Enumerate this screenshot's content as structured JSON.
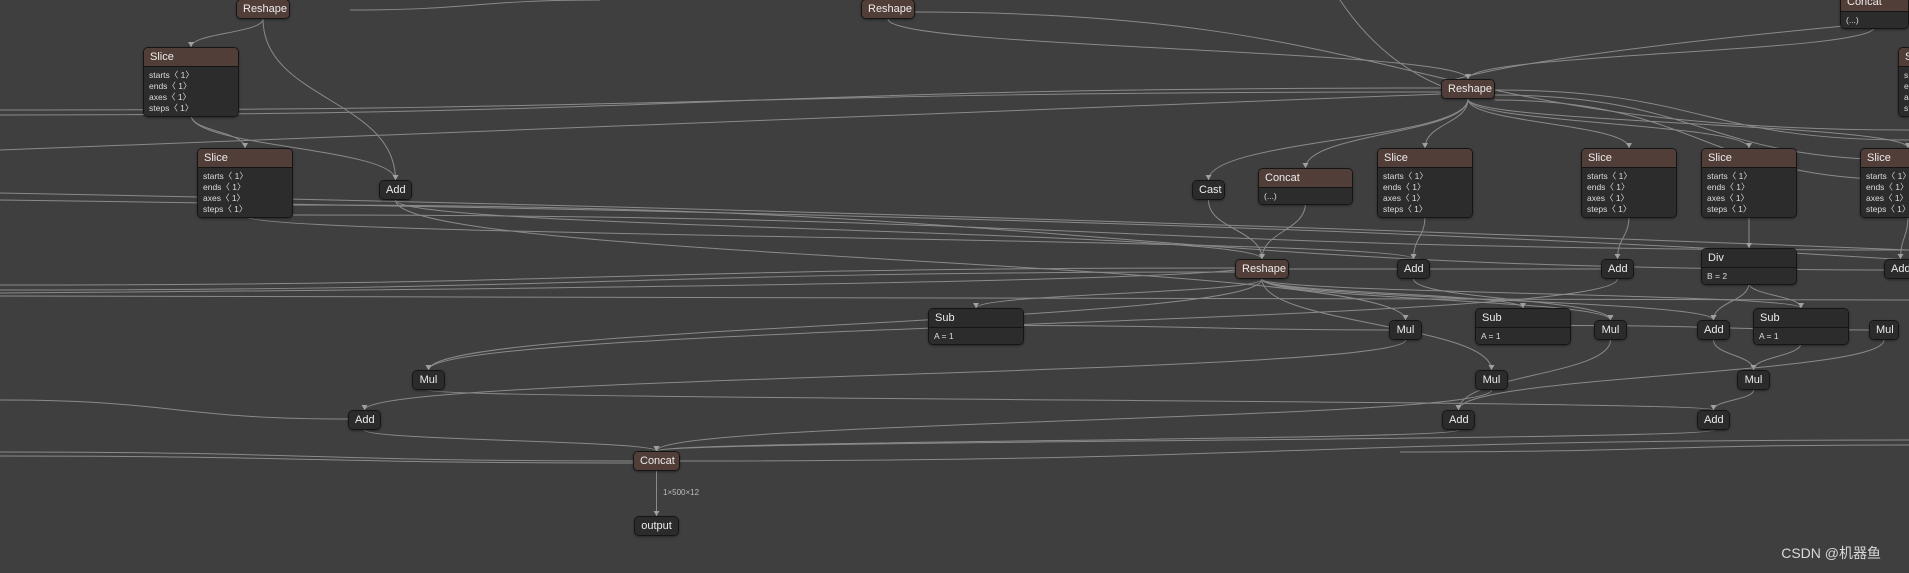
{
  "graph": {
    "nodes": [
      {
        "id": "reshape_top1",
        "op": "Reshape",
        "style": "layer"
      },
      {
        "id": "reshape_top2",
        "op": "Reshape",
        "style": "layer"
      },
      {
        "id": "concat_topright",
        "op": "Concat",
        "style": "layer",
        "attrs": [
          "(...)"
        ]
      },
      {
        "id": "slice1",
        "op": "Slice",
        "style": "layer",
        "attrs": [
          "starts〈 1〉",
          "ends〈 1〉",
          "axes〈 1〉",
          "steps〈 1〉"
        ]
      },
      {
        "id": "slice_right_edge",
        "op": "S",
        "style": "layer",
        "attrs": [
          "s",
          "e",
          "a",
          "s"
        ]
      },
      {
        "id": "reshape_mid",
        "op": "Reshape",
        "style": "layer"
      },
      {
        "id": "slice2",
        "op": "Slice",
        "style": "layer",
        "attrs": [
          "starts〈 1〉",
          "ends〈 1〉",
          "axes〈 1〉",
          "steps〈 1〉"
        ]
      },
      {
        "id": "add1",
        "op": "Add",
        "style": "op"
      },
      {
        "id": "cast",
        "op": "Cast",
        "style": "op"
      },
      {
        "id": "concat_mid",
        "op": "Concat",
        "style": "layer",
        "attrs": [
          "(...)"
        ]
      },
      {
        "id": "slice3",
        "op": "Slice",
        "style": "layer",
        "attrs": [
          "starts〈 1〉",
          "ends〈 1〉",
          "axes〈 1〉",
          "steps〈 1〉"
        ]
      },
      {
        "id": "slice4",
        "op": "Slice",
        "style": "layer",
        "attrs": [
          "starts〈 1〉",
          "ends〈 1〉",
          "axes〈 1〉",
          "steps〈 1〉"
        ]
      },
      {
        "id": "slice5",
        "op": "Slice",
        "style": "layer",
        "attrs": [
          "starts〈 1〉",
          "ends〈 1〉",
          "axes〈 1〉",
          "steps〈 1〉"
        ]
      },
      {
        "id": "slice6",
        "op": "Slice",
        "style": "layer",
        "attrs": [
          "starts〈 1〉",
          "ends〈 1〉",
          "axes〈 1〉",
          "steps〈 1〉"
        ]
      },
      {
        "id": "reshape_main",
        "op": "Reshape",
        "style": "layer"
      },
      {
        "id": "add2",
        "op": "Add",
        "style": "op"
      },
      {
        "id": "add3",
        "op": "Add",
        "style": "op"
      },
      {
        "id": "div",
        "op": "Div",
        "style": "op",
        "attrs": [
          "B = 2"
        ]
      },
      {
        "id": "add4",
        "op": "Add",
        "style": "op"
      },
      {
        "id": "sub1",
        "op": "Sub",
        "style": "op",
        "attrs": [
          "A = 1"
        ]
      },
      {
        "id": "mul1",
        "op": "Mul",
        "style": "op"
      },
      {
        "id": "sub2",
        "op": "Sub",
        "style": "op",
        "attrs": [
          "A = 1"
        ]
      },
      {
        "id": "mul2",
        "op": "Mul",
        "style": "op"
      },
      {
        "id": "add5",
        "op": "Add",
        "style": "op"
      },
      {
        "id": "sub3",
        "op": "Sub",
        "style": "op",
        "attrs": [
          "A = 1"
        ]
      },
      {
        "id": "mul3",
        "op": "Mul",
        "style": "op"
      },
      {
        "id": "mul4",
        "op": "Mul",
        "style": "op"
      },
      {
        "id": "mul5",
        "op": "Mul",
        "style": "op"
      },
      {
        "id": "mul6",
        "op": "Mul",
        "style": "op"
      },
      {
        "id": "add6",
        "op": "Add",
        "style": "op"
      },
      {
        "id": "add7",
        "op": "Add",
        "style": "op"
      },
      {
        "id": "add8",
        "op": "Add",
        "style": "op"
      },
      {
        "id": "concat_final",
        "op": "Concat",
        "style": "layer"
      },
      {
        "id": "output",
        "op": "output",
        "style": "io"
      }
    ],
    "edges": [
      [
        "reshape_top1",
        "add1"
      ],
      [
        "reshape_top1",
        "slice1"
      ],
      [
        "reshape_top2",
        "reshape_mid"
      ],
      [
        "concat_topright",
        "reshape_mid"
      ],
      [
        "slice1",
        "slice2"
      ],
      [
        "slice1",
        "add1"
      ],
      [
        "reshape_mid",
        "cast"
      ],
      [
        "reshape_mid",
        "concat_mid"
      ],
      [
        "reshape_mid",
        "slice3"
      ],
      [
        "reshape_mid",
        "slice4"
      ],
      [
        "reshape_mid",
        "slice5"
      ],
      [
        "reshape_mid",
        "slice6"
      ],
      [
        "slice2",
        "add2"
      ],
      [
        "add1",
        "reshape_main"
      ],
      [
        "add1",
        "mul1"
      ],
      [
        "cast",
        "reshape_main"
      ],
      [
        "concat_mid",
        "reshape_main"
      ],
      [
        "slice3",
        "add2"
      ],
      [
        "slice4",
        "add3"
      ],
      [
        "slice5",
        "div"
      ],
      [
        "slice6",
        "add4"
      ],
      [
        "reshape_main",
        "sub1"
      ],
      [
        "reshape_main",
        "add2"
      ],
      [
        "reshape_main",
        "add3"
      ],
      [
        "reshape_main",
        "mul2"
      ],
      [
        "reshape_main",
        "sub2"
      ],
      [
        "reshape_main",
        "mul4"
      ],
      [
        "reshape_main",
        "add5"
      ],
      [
        "reshape_main",
        "sub3"
      ],
      [
        "reshape_main",
        "mul5"
      ],
      [
        "add2",
        "mul2"
      ],
      [
        "add3",
        "mul4"
      ],
      [
        "div",
        "add5"
      ],
      [
        "div",
        "sub3"
      ],
      [
        "sub1",
        "mul1"
      ],
      [
        "sub2",
        "mul3"
      ],
      [
        "add5",
        "mul6"
      ],
      [
        "sub3",
        "mul6"
      ],
      [
        "mul1",
        "add6"
      ],
      [
        "mul2",
        "add7"
      ],
      [
        "mul3",
        "add7"
      ],
      [
        "mul4",
        "add8"
      ],
      [
        "mul6",
        "add8"
      ],
      [
        "add6",
        "concat_final"
      ],
      [
        "add7",
        "concat_final"
      ],
      [
        "add8",
        "concat_final"
      ],
      [
        "mul5",
        "concat_final"
      ],
      [
        "concat_final",
        "output"
      ]
    ],
    "edge_labels": {
      "concat_final_output": "1×500×12"
    }
  },
  "colors": {
    "background": "#3f3f3f",
    "layer_header": "#523e38",
    "op_header": "#2b2b2b",
    "edge": "#8a8a8a"
  },
  "watermark": "CSDN @机器鱼"
}
